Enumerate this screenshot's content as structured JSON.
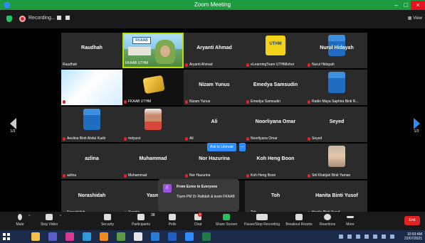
{
  "window": {
    "title": "Zoom Meeting"
  },
  "top_bar": {
    "recording_label": "Recording...",
    "view_label": "View"
  },
  "pages": {
    "prev_label": "1/3",
    "next_label": "1/3"
  },
  "tiles": [
    {
      "name": "Raudhah",
      "footer": "Raudhah",
      "muted": false
    },
    {
      "name": "",
      "footer": "FKAAB UTHM",
      "muted": false
    },
    {
      "name": "Aryanti Ahmad",
      "footer": "Aryanti Ahmad",
      "muted": true
    },
    {
      "name": "",
      "footer": "eLearningTeam UTHMlohor",
      "muted": true
    },
    {
      "name": "Nurul Hidayah",
      "footer": "Nurul Hidayah",
      "muted": true
    },
    {
      "name": "",
      "footer": "Mohd Effendi Daud",
      "muted": true
    },
    {
      "name": "",
      "footer": "FKAAB UTHM",
      "muted": true
    },
    {
      "name": "Nizam Yunus",
      "footer": "Nizam Yunus",
      "muted": true
    },
    {
      "name": "Emedya Samsudin",
      "footer": "Emedya Samsudin",
      "muted": true
    },
    {
      "name": "",
      "footer": "Radin Maya Saphira Binti R...",
      "muted": true
    },
    {
      "name": "",
      "footer": "Aeslina Binti Abdul Kadir",
      "muted": true
    },
    {
      "name": "",
      "footer": "mdyusri",
      "muted": true
    },
    {
      "name": "Ali",
      "footer": "Ali",
      "muted": true
    },
    {
      "name": "Noorliyana Omar",
      "footer": "Noorliyana Omar",
      "muted": true
    },
    {
      "name": "Seyed",
      "footer": "Seyed",
      "muted": true
    },
    {
      "name": "azlina",
      "footer": "azlina",
      "muted": true
    },
    {
      "name": "Muhammad",
      "footer": "Muhammad",
      "muted": true
    },
    {
      "name": "Nor Hazurina",
      "footer": "Nor Hazurina",
      "muted": true
    },
    {
      "name": "Koh Heng Boon",
      "footer": "Koh Heng Boon",
      "muted": true
    },
    {
      "name": "",
      "footer": "Siti Khatijah Binti Yaman",
      "muted": true
    },
    {
      "name": "Norashidah",
      "footer": "Norashidah",
      "muted": true
    },
    {
      "name": "Yasm",
      "footer": "Yasmin",
      "muted": true
    },
    {
      "name": "",
      "footer": "",
      "muted": false
    },
    {
      "name": "Toh",
      "footer": "Toh",
      "muted": true
    },
    {
      "name": "Hanita Binti Yusof",
      "footer": "Hanita Binti Yusof",
      "muted": true
    }
  ],
  "video_sign": "FKAAB",
  "ask_unmute": {
    "label": "Ask to Unmute",
    "more": "..."
  },
  "chat_popup": {
    "badge": "E",
    "from": "From Ezree to Everyone",
    "message": "Tqvm PM Dr Rafidah & team FKAAB"
  },
  "toolbar": {
    "mute": "Mute",
    "stop_video": "Stop Video",
    "security": "Security",
    "participants": "Participants",
    "participants_count": "38",
    "polls": "Polls",
    "chat": "Chat",
    "chat_badge": "6",
    "share_screen": "Share Screen",
    "pause_recording": "Pause/Stop Recording",
    "breakout_rooms": "Breakout Rooms",
    "reactions": "Reactions",
    "more": "More",
    "end": "End"
  },
  "clock": {
    "time": "10:59 AM",
    "date": "22/07/2021"
  },
  "colors": {
    "title_green": "#1e9b3e",
    "zoom_blue": "#2d8cff",
    "end_red": "#e02424",
    "speaker_border": "#b9e000"
  }
}
